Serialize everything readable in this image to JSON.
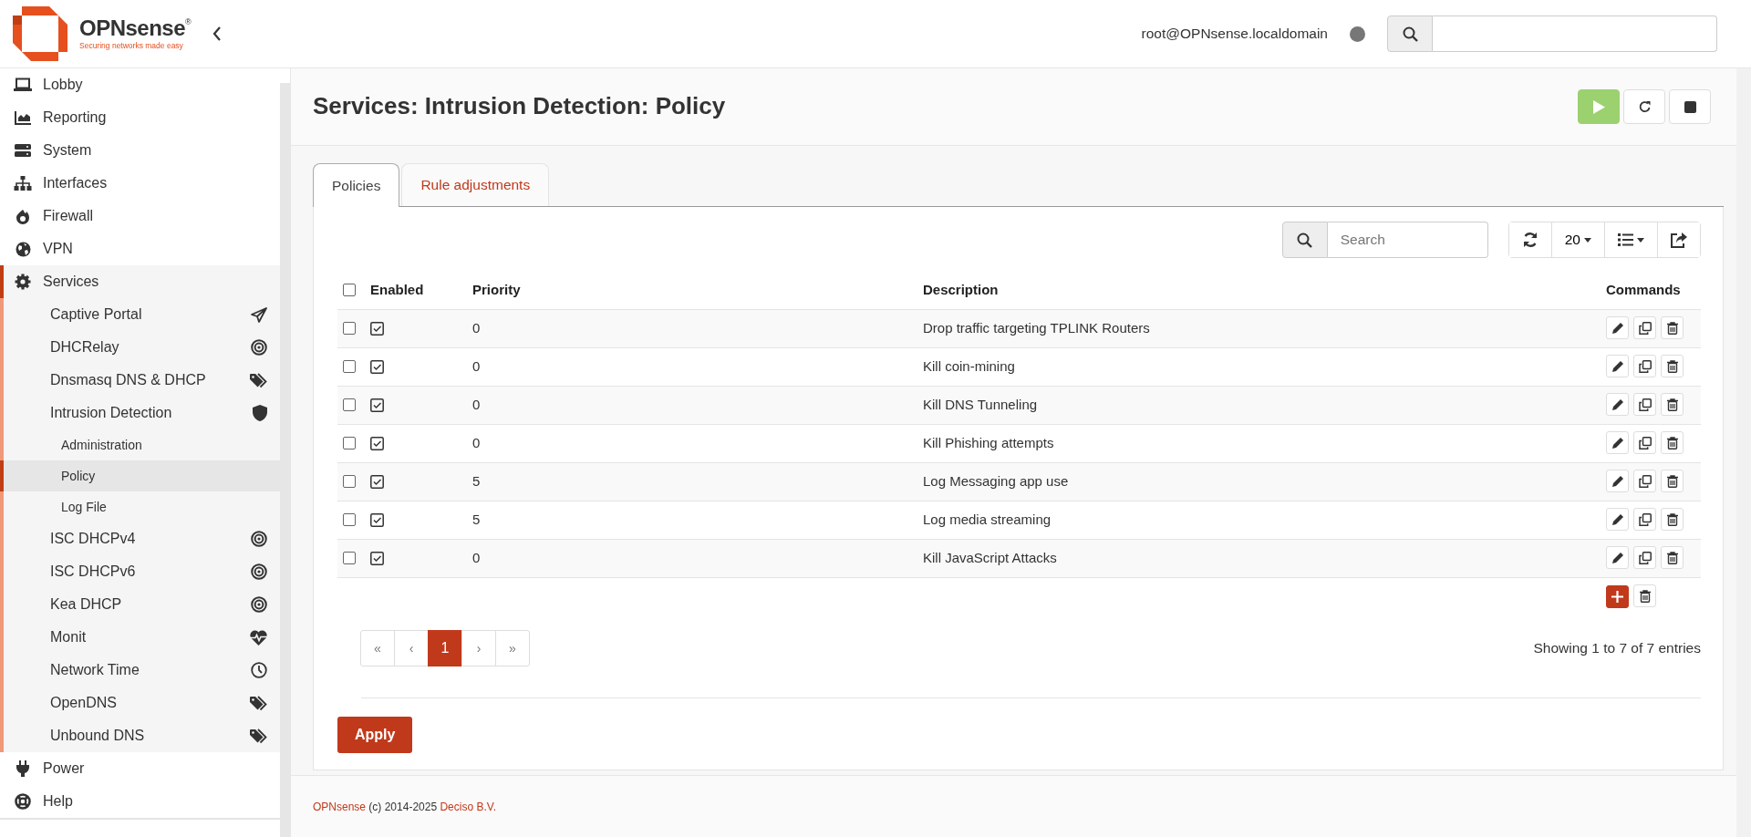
{
  "header": {
    "logo_name": "OPNsense$^{®}$",
    "logo_tagline": "Securing networks made easy",
    "user": "root@OPNsense.localdomain"
  },
  "menu": [
    {
      "label": "Lobby",
      "selected": false
    },
    {
      "label": "Reporting",
      "selected": false
    },
    {
      "label": "System",
      "selected": false
    },
    {
      "label": "Interfaces",
      "selected": false
    },
    {
      "label": "Firewall",
      "selected": false
    },
    {
      "label": "VPN",
      "selected": false
    },
    {
      "label": "Services",
      "selected": false,
      "expanded": true,
      "children": [
        {
          "label": "Captive Portal",
          "selected": false
        },
        {
          "label": "DHCRelay",
          "selected": false
        },
        {
          "label": "Dnsmasq DNS & DHCP",
          "selected": false
        },
        {
          "label": "Intrusion Detection",
          "selected": false,
          "expanded": true,
          "children": [
            {
              "label": "Administration",
              "selected": false
            },
            {
              "label": "Policy",
              "selected": true
            },
            {
              "label": "Log File",
              "selected": false
            }
          ]
        },
        {
          "label": "ISC DHCPv4",
          "selected": false
        },
        {
          "label": "ISC DHCPv6",
          "selected": false
        },
        {
          "label": "Kea DHCP",
          "selected": false
        },
        {
          "label": "Monit",
          "selected": false
        },
        {
          "label": "Network Time",
          "selected": false
        },
        {
          "label": "OpenDNS",
          "selected": false
        },
        {
          "label": "Unbound DNS",
          "selected": false
        }
      ]
    },
    {
      "label": "Power",
      "selected": false
    },
    {
      "label": "Help",
      "selected": false
    }
  ],
  "page": {
    "title": "Services: Intrusion Detection: Policy",
    "tabs": [
      {
        "label": "Policies",
        "selected": true
      },
      {
        "label": "Rule adjustments",
        "selected": false
      }
    ],
    "grid": {
      "search": {
        "placeholder": "Search"
      },
      "page_size": "20",
      "select_all": false,
      "columns": [
        "Enabled",
        "Priority",
        "Description",
        "Commands"
      ],
      "rows": [
        {
          "selected": false,
          "enabled": true,
          "priority": "0",
          "description": "Drop traffic targeting TPLINK Routers"
        },
        {
          "selected": false,
          "enabled": true,
          "priority": "0",
          "description": "Kill coin-mining"
        },
        {
          "selected": false,
          "enabled": true,
          "priority": "0",
          "description": "Kill DNS Tunneling"
        },
        {
          "selected": false,
          "enabled": true,
          "priority": "0",
          "description": "Kill Phishing attempts"
        },
        {
          "selected": false,
          "enabled": true,
          "priority": "5",
          "description": "Log Messaging app use"
        },
        {
          "selected": false,
          "enabled": true,
          "priority": "5",
          "description": "Log media streaming"
        },
        {
          "selected": false,
          "enabled": true,
          "priority": "0",
          "description": "Kill JavaScript Attacks"
        }
      ],
      "pagination": [
        {
          "label": "«",
          "selected": false
        },
        {
          "label": "‹",
          "selected": false
        },
        {
          "label": "1",
          "selected": true
        },
        {
          "label": "›",
          "selected": false
        },
        {
          "label": "»",
          "selected": false
        }
      ],
      "info": "Showing 1 to 7 of 7 entries"
    },
    "apply_button": "Apply"
  },
  "footer": {
    "brand": "OPNsense",
    "text": " (c) 2014-2025 ",
    "company": "Deciso B.V."
  }
}
